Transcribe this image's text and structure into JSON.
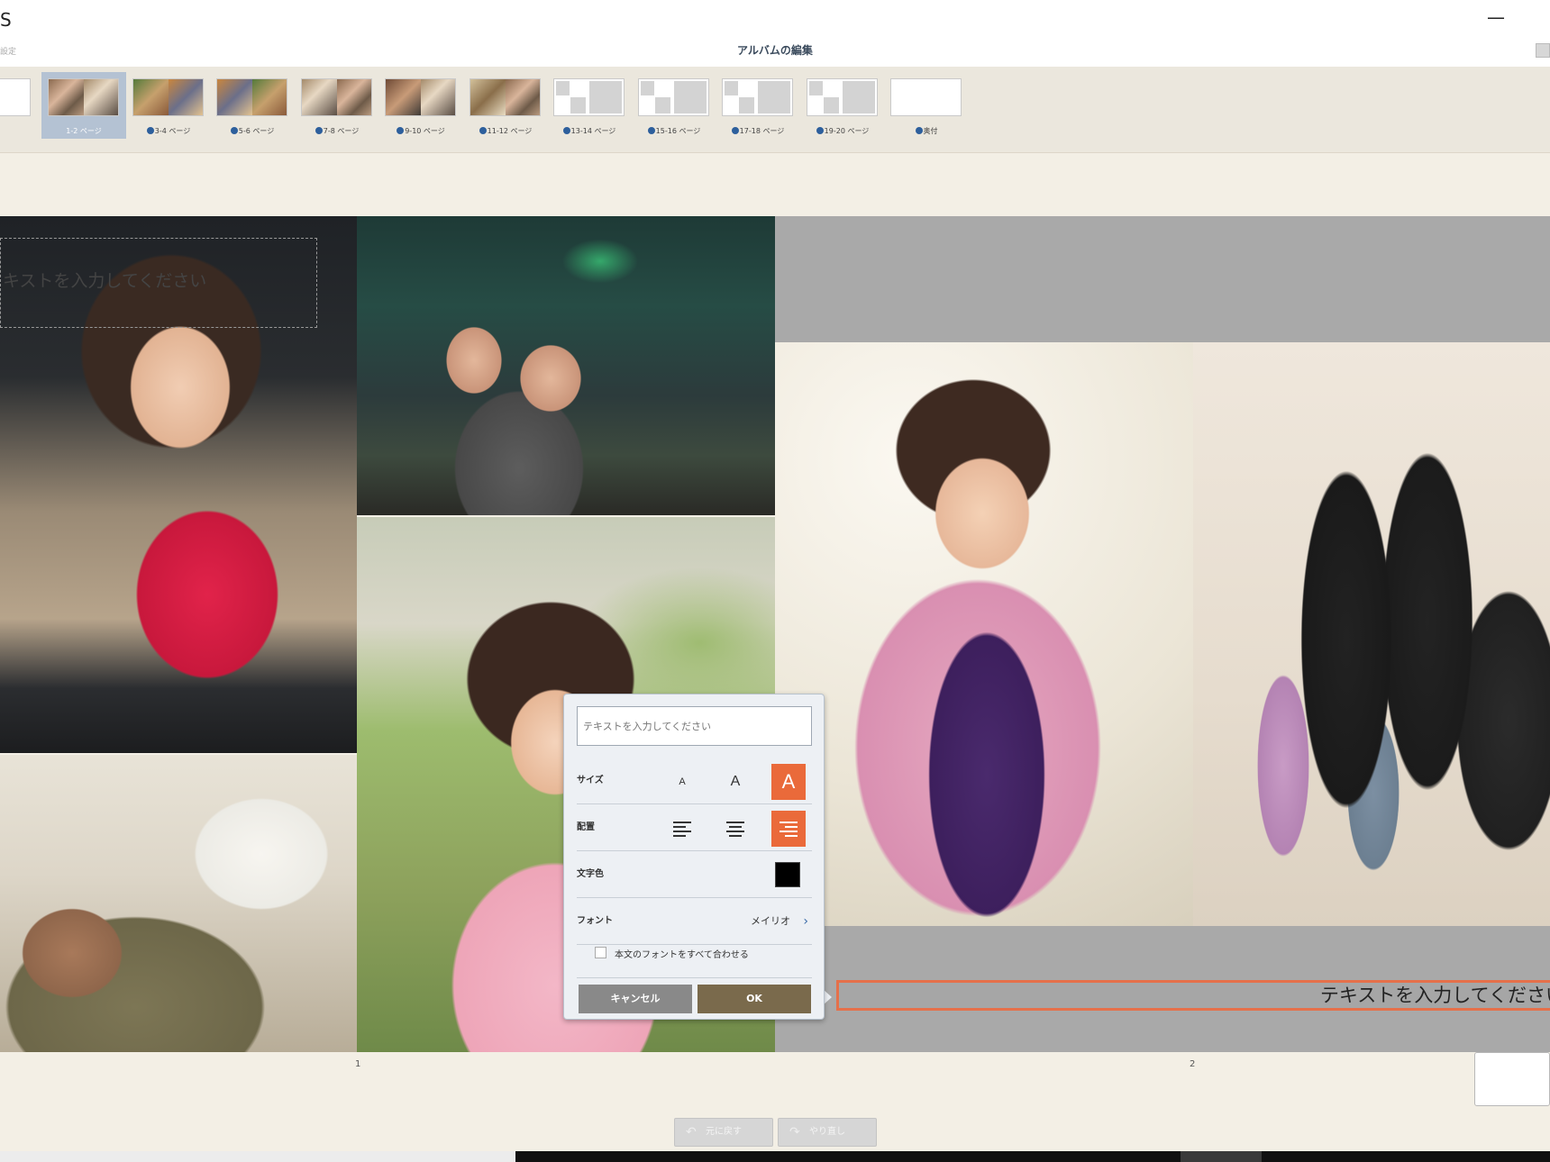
{
  "window": {
    "app_letter": "S",
    "minimize_glyph": "—",
    "settings_label": "設定",
    "page_heading": "アルバムの編集"
  },
  "thumbnails": [
    {
      "label": "",
      "selected": false,
      "dot": false
    },
    {
      "label": "1-2 ページ",
      "selected": true,
      "dot": false
    },
    {
      "label": "3-4 ページ",
      "selected": false,
      "dot": true
    },
    {
      "label": "5-6 ページ",
      "selected": false,
      "dot": true
    },
    {
      "label": "7-8 ページ",
      "selected": false,
      "dot": true
    },
    {
      "label": "9-10 ページ",
      "selected": false,
      "dot": true
    },
    {
      "label": "11-12 ページ",
      "selected": false,
      "dot": true
    },
    {
      "label": "13-14 ページ",
      "selected": false,
      "dot": true
    },
    {
      "label": "15-16 ページ",
      "selected": false,
      "dot": true
    },
    {
      "label": "17-18 ページ",
      "selected": false,
      "dot": true
    },
    {
      "label": "19-20 ページ",
      "selected": false,
      "dot": true
    },
    {
      "label": "奥付",
      "selected": false,
      "dot": true
    }
  ],
  "canvas": {
    "left_placeholder": "キストを入力してください",
    "right_textbox": "テキストを入力してください"
  },
  "editor": {
    "input_placeholder": "テキストを入力してください",
    "size_label": "サイズ",
    "size_options": [
      "A",
      "A",
      "A"
    ],
    "size_selected_index": 2,
    "align_label": "配置",
    "align_options": [
      "left",
      "center",
      "right"
    ],
    "align_selected": "right",
    "color_label": "文字色",
    "color_value": "#000000",
    "font_label": "フォント",
    "font_value": "メイリオ",
    "match_fonts_label": "本文のフォントをすべて合わせる",
    "match_fonts_checked": false,
    "cancel_label": "キャンセル",
    "ok_label": "OK",
    "accent_color": "#ea6a3a"
  },
  "page_numbers": {
    "left": "1",
    "right": "2"
  },
  "history": {
    "undo_label": "元に戻す",
    "redo_label": "やり直し",
    "undo_icon": "undo-arrow-icon",
    "redo_icon": "redo-arrow-icon"
  }
}
